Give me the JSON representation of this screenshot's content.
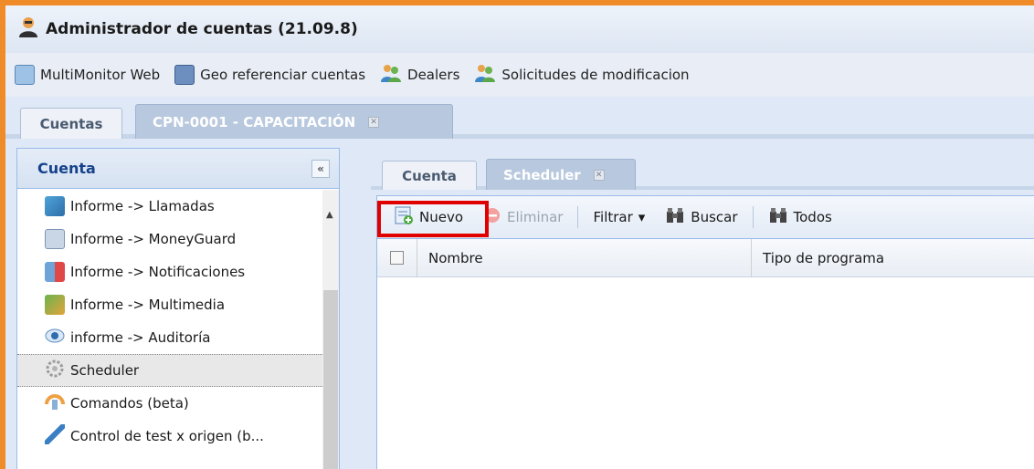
{
  "window": {
    "title": "Administrador de cuentas (21.09.8)"
  },
  "top_toolbar": {
    "items": [
      {
        "label": "MultiMonitor Web",
        "icon": "grid-monitor-icon"
      },
      {
        "label": "Geo referenciar cuentas",
        "icon": "computer-icon"
      },
      {
        "label": "Dealers",
        "icon": "users-icon"
      },
      {
        "label": "Solicitudes de modificacion",
        "icon": "users-icon"
      }
    ]
  },
  "main_tabs": [
    {
      "label": "Cuentas"
    },
    {
      "label": "CPN-0001 - CAPACITACIÓN",
      "close": "✕"
    }
  ],
  "left_panel": {
    "title": "Cuenta",
    "collapse_label": "«",
    "items": [
      {
        "label": "Informe -> Llamadas",
        "icon": "phone-report-icon"
      },
      {
        "label": "Informe -> MoneyGuard",
        "icon": "moneyguard-icon"
      },
      {
        "label": "Informe -> Notificaciones",
        "icon": "notification-icon"
      },
      {
        "label": "Informe -> Multimedia",
        "icon": "multimedia-icon"
      },
      {
        "label": "informe -> Auditoría",
        "icon": "eye-icon"
      },
      {
        "label": "Scheduler",
        "icon": "gear-icon",
        "selected": true
      },
      {
        "label": "Comandos (beta)",
        "icon": "commands-icon"
      },
      {
        "label": "Control de test x origen (b...",
        "icon": "plug-icon"
      }
    ]
  },
  "content_tabs": [
    {
      "label": "Cuenta"
    },
    {
      "label": "Scheduler",
      "close": "✕"
    }
  ],
  "content_toolbar": {
    "nuevo": "Nuevo",
    "eliminar": "Eliminar",
    "filtrar": "Filtrar",
    "filtrar_arrow": "▾",
    "buscar": "Buscar",
    "todos": "Todos"
  },
  "grid": {
    "columns": [
      "Nombre",
      "Tipo de programa"
    ]
  },
  "colors": {
    "frame": "#f08b2a",
    "highlight": "#e00000",
    "header_text": "#15428b"
  }
}
